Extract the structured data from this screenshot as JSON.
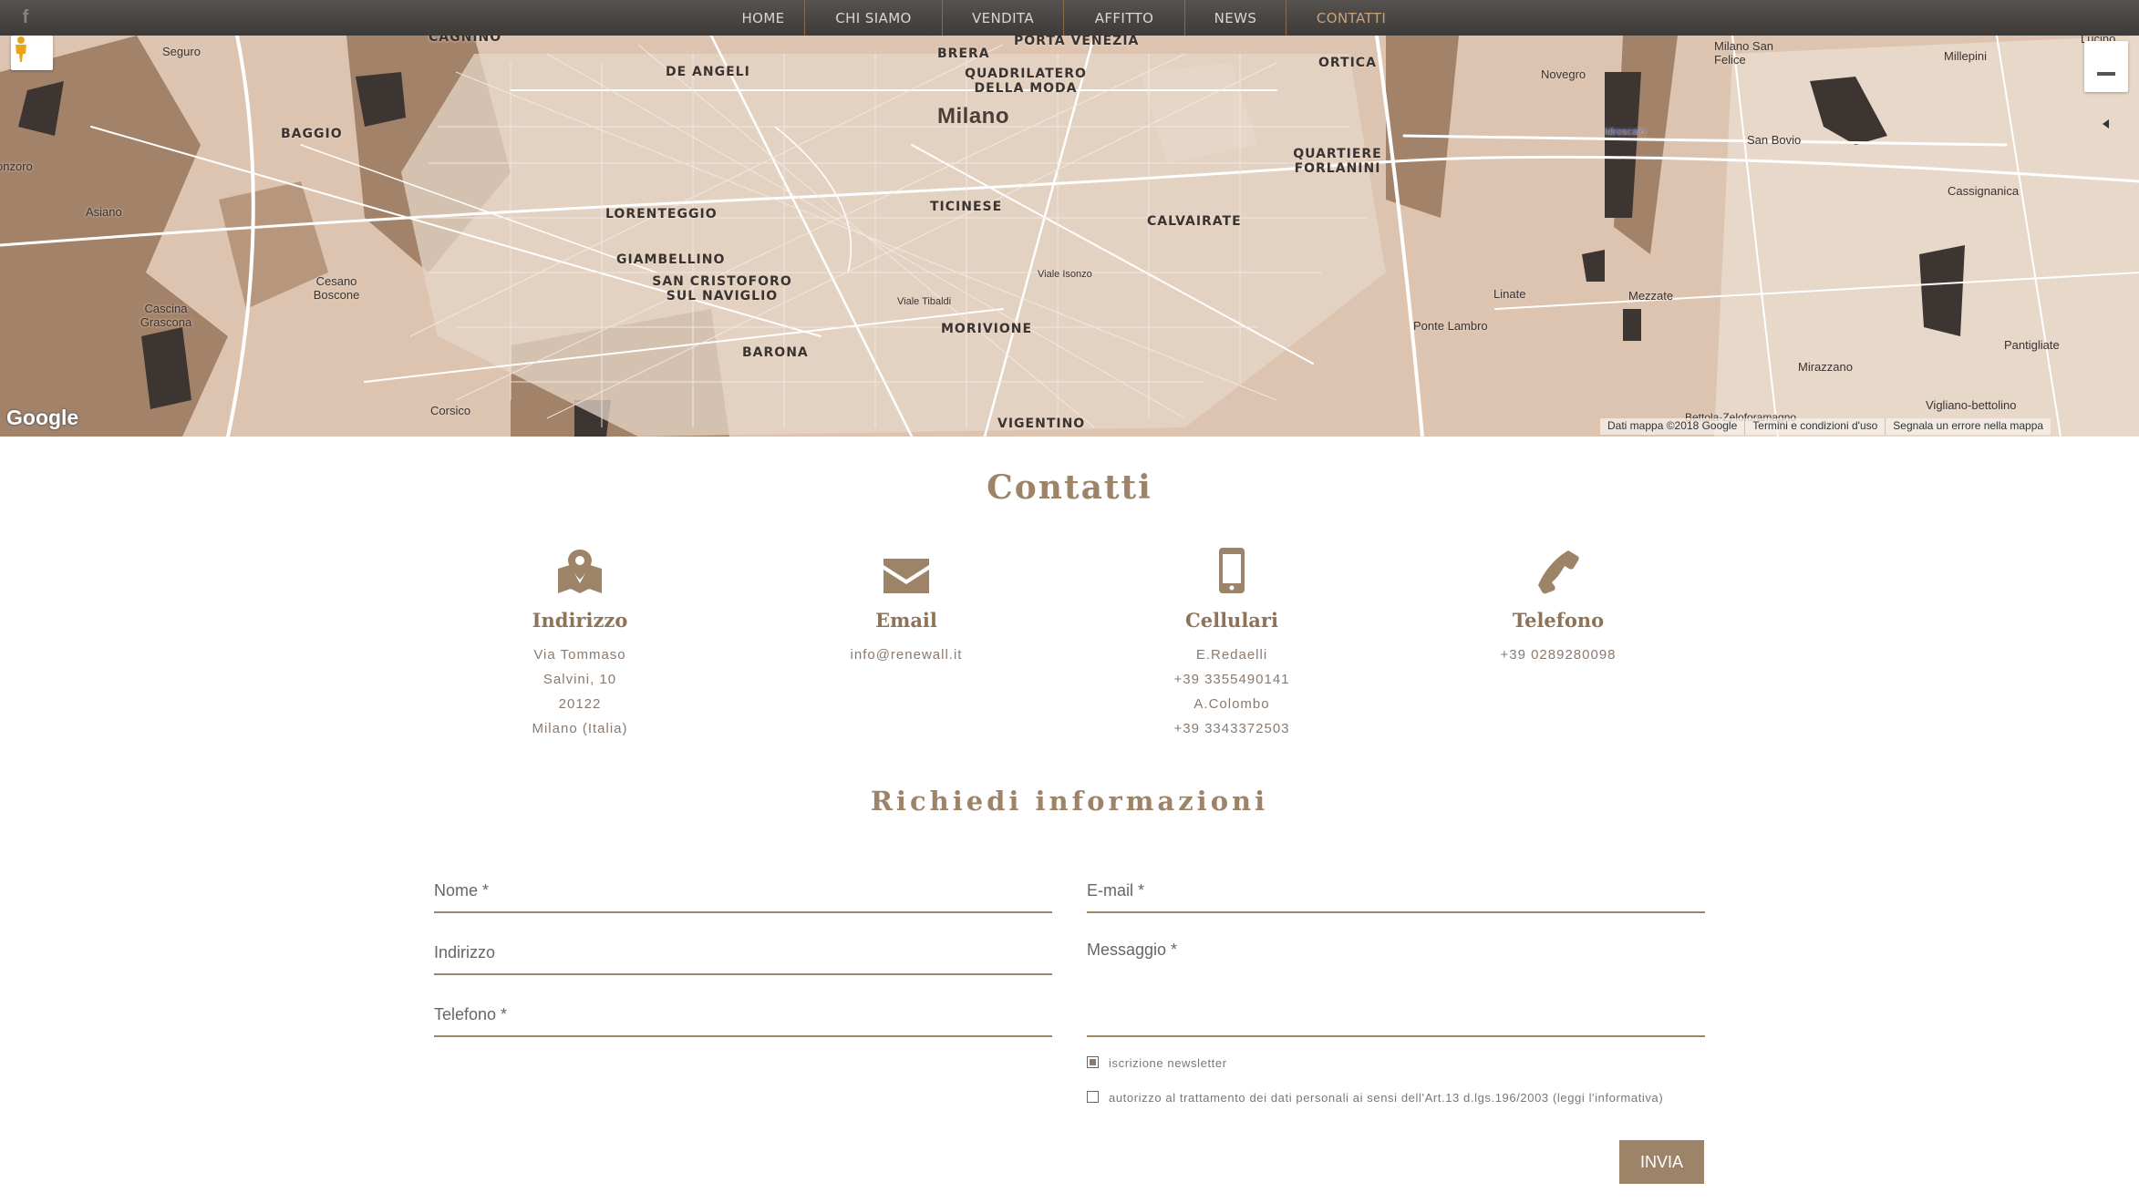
{
  "nav": {
    "facebook_icon": "facebook-icon",
    "items": [
      {
        "label": "HOME"
      },
      {
        "label": "CHI SIAMO"
      },
      {
        "label": "VENDITA"
      },
      {
        "label": "AFFITTO"
      },
      {
        "label": "NEWS"
      },
      {
        "label": "CONTATTI",
        "active": true
      }
    ],
    "active_color": "#c9a27a"
  },
  "map": {
    "city": "Milano",
    "labels": [
      "Seguro",
      "CAGNINO",
      "DE ANGELI",
      "BRERA",
      "PORTA VENEZIA",
      "QUADRILATERO DELLA MODA",
      "ORTICA",
      "Milano San Felice",
      "Millepini",
      "Novegro",
      "BAGGIO",
      "onzoro",
      "Asiano",
      "LORENTEGGIO",
      "TICINESE",
      "CALVAIRATE",
      "QUARTIERE FORLANINI",
      "San Bovio",
      "Cassignanica",
      "GIAMBELLINO",
      "SAN CRISTOFORO SUL NAVIGLIO",
      "Cesano Boscone",
      "Cascina Grascona",
      "MORIVIONE",
      "Linate",
      "Mezzate",
      "Ponte Lambro",
      "BARONA",
      "Pantigliate",
      "Mirazzano",
      "Corsico",
      "VIGENTINO",
      "Vigliano-bettolino",
      "Viale Isonzo",
      "Viale Tibaldi",
      "Idroscalo",
      "Lucino",
      "Bettola-Zeloforamagno"
    ],
    "logo": "Google",
    "attribution": [
      "Dati mappa ©2018 Google",
      "Termini e condizioni d'uso",
      "Segnala un errore nella mappa"
    ],
    "pegman_icon": "pegman-icon",
    "zoom_out_icon": "zoom-out-icon"
  },
  "contact": {
    "title": "Contatti",
    "columns": [
      {
        "icon": "map-pin-icon",
        "title": "Indirizzo",
        "lines": [
          "Via Tommaso",
          "Salvini, 10",
          "20122",
          "Milano (Italia)"
        ]
      },
      {
        "icon": "envelope-icon",
        "title": "Email",
        "lines": [
          "info@renewall.it"
        ]
      },
      {
        "icon": "mobile-phone-icon",
        "title": "Cellulari",
        "lines": [
          "E.Redaelli",
          "+39 3355490141",
          "A.Colombo",
          "+39 3343372503"
        ]
      },
      {
        "icon": "phone-icon",
        "title": "Telefono",
        "lines": [
          "+39 0289280098"
        ]
      }
    ]
  },
  "form": {
    "title": "Richiedi informazioni",
    "fields": {
      "nome": {
        "placeholder": "Nome *",
        "value": ""
      },
      "email": {
        "placeholder": "E-mail *",
        "value": ""
      },
      "indirizzo": {
        "placeholder": "Indirizzo",
        "value": ""
      },
      "messaggio": {
        "placeholder": "Messaggio *",
        "value": ""
      },
      "telefono": {
        "placeholder": "Telefono *",
        "value": ""
      }
    },
    "newsletter_label": "iscrizione newsletter",
    "newsletter_checked": true,
    "privacy_label": "autorizzo al trattamento dei dati personali ai sensi dell'Art.13 d.lgs.196/2003 (leggi l'informativa)",
    "privacy_checked": false,
    "submit_label": "INVIA",
    "accent_color": "#9d8469"
  }
}
